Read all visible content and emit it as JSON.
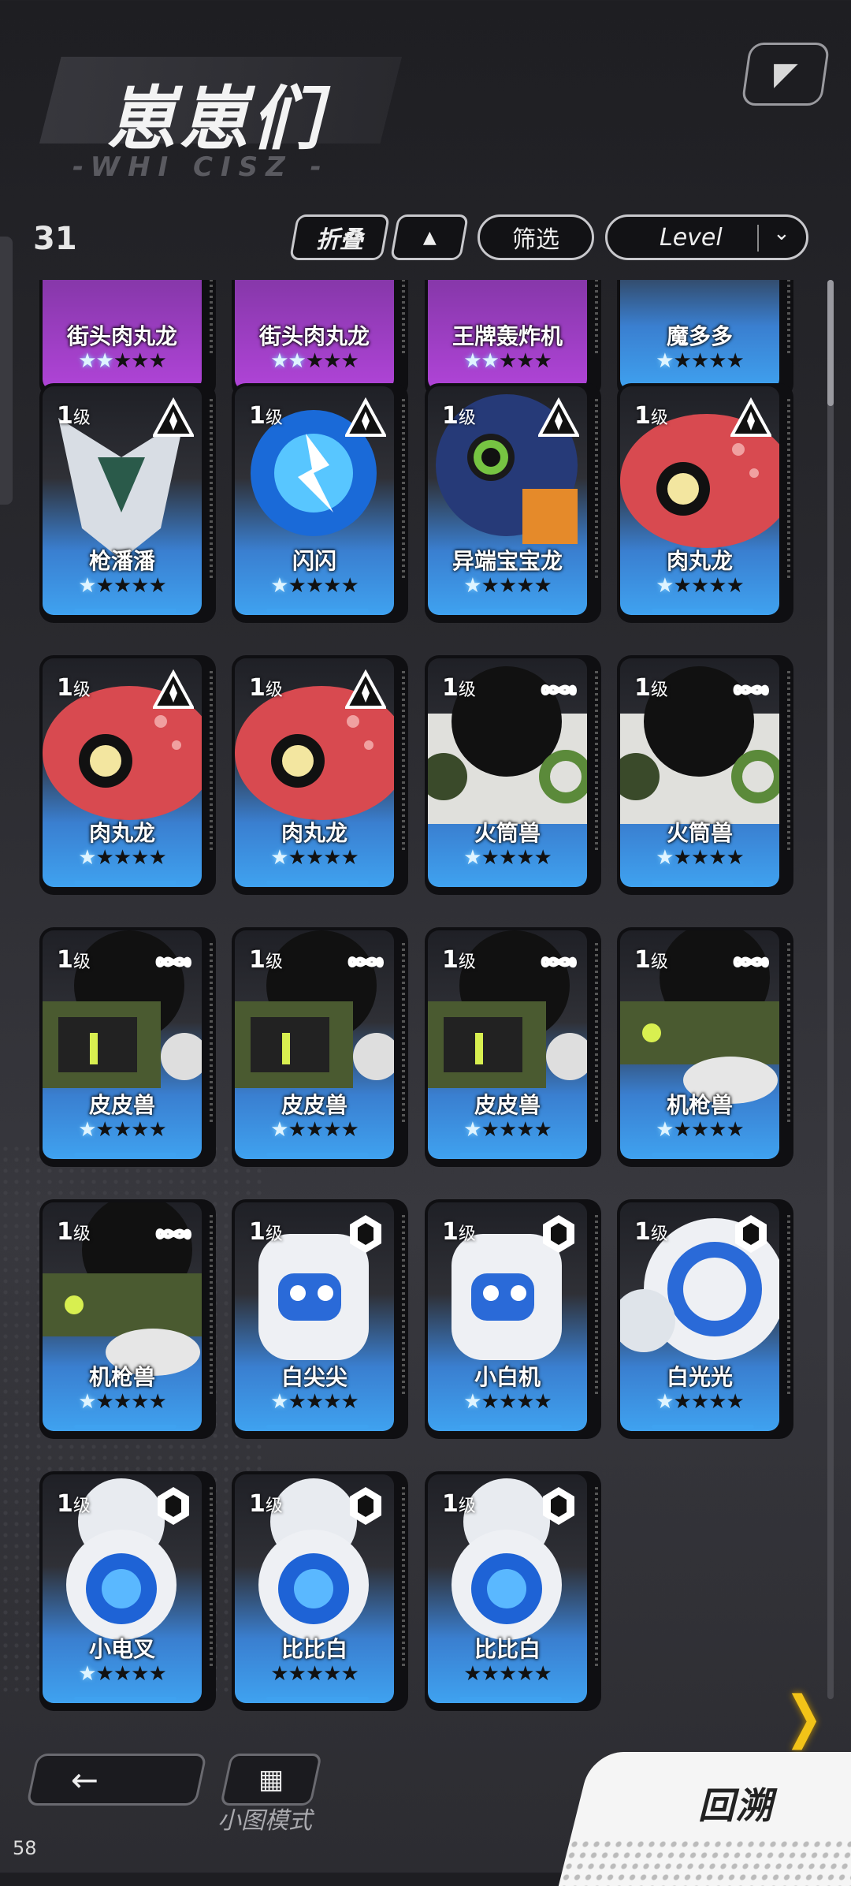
{
  "header": {
    "title": "崽崽们",
    "subtitle": "-WHI CISZ -",
    "corner_icon": "brand-logo-icon"
  },
  "toolbar": {
    "count": "31",
    "fold_label": "折叠",
    "sort_icon": "triangle-up-icon",
    "filter_label": "筛选",
    "sort_value": "Level",
    "dropdown_icon": "chevron-down-icon"
  },
  "cards": [
    {
      "name": "街头肉丸龙",
      "level": "",
      "lit": 2,
      "style": "purple",
      "badge": ""
    },
    {
      "name": "街头肉丸龙",
      "level": "",
      "lit": 2,
      "style": "purple",
      "badge": ""
    },
    {
      "name": "王牌轰炸机",
      "level": "",
      "lit": 2,
      "style": "purple",
      "badge": ""
    },
    {
      "name": "魔多多",
      "level": "",
      "lit": 1,
      "style": "blue",
      "badge": ""
    },
    {
      "name": "枪潘潘",
      "level": "1",
      "lit": 1,
      "style": "blue",
      "badge": "triangle",
      "art": "crystal"
    },
    {
      "name": "闪闪",
      "level": "1",
      "lit": 1,
      "style": "blue",
      "badge": "triangle",
      "art": "spark"
    },
    {
      "name": "异端宝宝龙",
      "level": "1",
      "lit": 1,
      "style": "blue",
      "badge": "triangle",
      "art": "navy"
    },
    {
      "name": "肉丸龙",
      "level": "1",
      "lit": 1,
      "style": "blue",
      "badge": "triangle",
      "art": "red"
    },
    {
      "name": "肉丸龙",
      "level": "1",
      "lit": 1,
      "style": "blue",
      "badge": "triangle",
      "art": "red"
    },
    {
      "name": "肉丸龙",
      "level": "1",
      "lit": 1,
      "style": "blue",
      "badge": "triangle",
      "art": "red"
    },
    {
      "name": "火筒兽",
      "level": "1",
      "lit": 1,
      "style": "blue",
      "badge": "infinity",
      "art": "cannon"
    },
    {
      "name": "火筒兽",
      "level": "1",
      "lit": 1,
      "style": "blue",
      "badge": "infinity",
      "art": "cannon"
    },
    {
      "name": "皮皮兽",
      "level": "1",
      "lit": 1,
      "style": "blue",
      "badge": "infinity",
      "art": "green"
    },
    {
      "name": "皮皮兽",
      "level": "1",
      "lit": 1,
      "style": "blue",
      "badge": "infinity",
      "art": "green"
    },
    {
      "name": "皮皮兽",
      "level": "1",
      "lit": 1,
      "style": "blue",
      "badge": "infinity",
      "art": "green"
    },
    {
      "name": "机枪兽",
      "level": "1",
      "lit": 1,
      "style": "blue",
      "badge": "infinity",
      "art": "gun"
    },
    {
      "name": "机枪兽",
      "level": "1",
      "lit": 1,
      "style": "blue",
      "badge": "infinity",
      "art": "gun"
    },
    {
      "name": "白尖尖",
      "level": "1",
      "lit": 1,
      "style": "blue",
      "badge": "hex",
      "art": "white"
    },
    {
      "name": "小白机",
      "level": "1",
      "lit": 1,
      "style": "blue",
      "badge": "hex",
      "art": "white"
    },
    {
      "name": "白光光",
      "level": "1",
      "lit": 1,
      "style": "blue",
      "badge": "hex",
      "art": "ring"
    },
    {
      "name": "小电叉",
      "level": "1",
      "lit": 1,
      "style": "blue",
      "badge": "hex",
      "art": "orb"
    },
    {
      "name": "比比白",
      "level": "1",
      "lit": 0,
      "style": "blue",
      "badge": "hex",
      "art": "orb"
    },
    {
      "name": "比比白",
      "level": "1",
      "lit": 0,
      "style": "blue",
      "badge": "hex",
      "art": "orb"
    }
  ],
  "level_suffix": "级",
  "star_char": "★",
  "footer": {
    "back_icon": "arrow-left-icon",
    "mode_icon": "grid-icon",
    "mode_label": "小图模式",
    "confirm_label": "回溯",
    "next_icon": "chevron-right-icon",
    "corner_number": "58"
  },
  "colors": {
    "accent": "#3fa2f0",
    "rare": "#b044d8",
    "next": "#f2c318"
  }
}
